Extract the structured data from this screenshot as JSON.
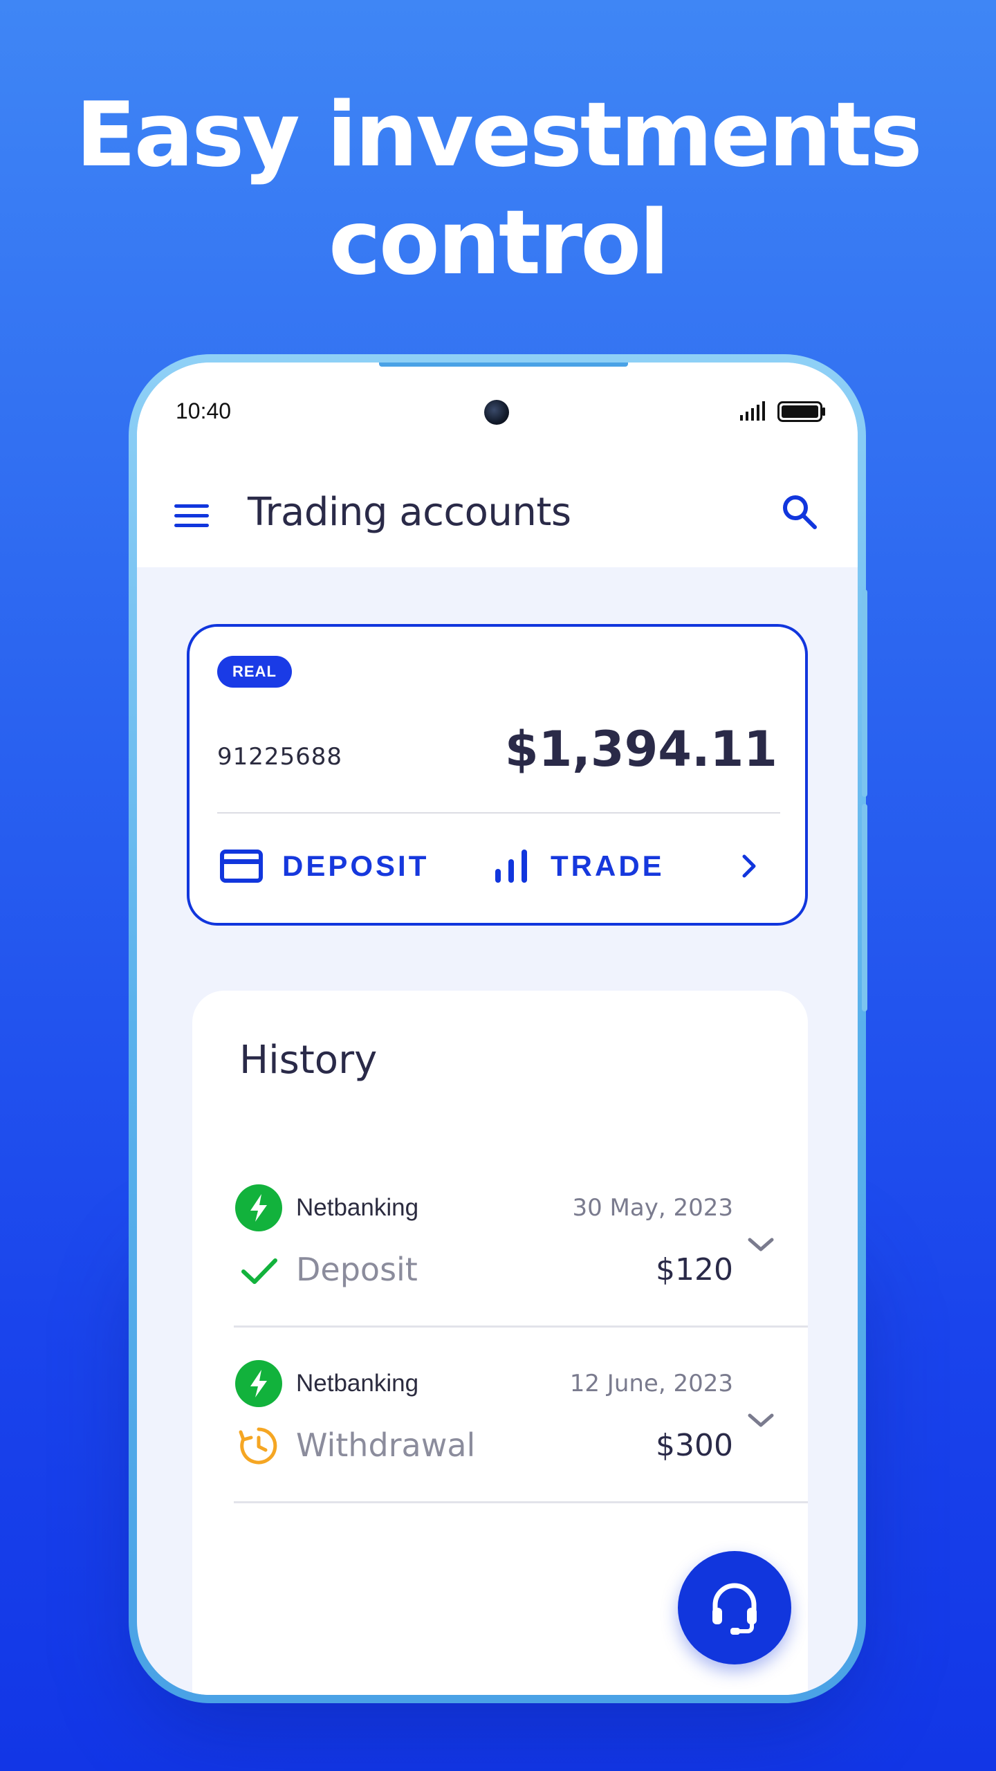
{
  "promo": {
    "headline_line1": "Easy investments",
    "headline_line2": "control"
  },
  "status_bar": {
    "time": "10:40",
    "icons": [
      "camera-hole",
      "signal-icon",
      "battery-icon"
    ]
  },
  "app_bar": {
    "title": "Trading accounts",
    "icons": [
      "menu-icon",
      "search-icon"
    ]
  },
  "account_card": {
    "badge": "REAL",
    "account_number": "91225688",
    "balance": "$1,394.11",
    "actions": [
      {
        "label": "DEPOSIT",
        "icon": "card-icon"
      },
      {
        "label": "TRADE",
        "icon": "bar-chart-icon"
      }
    ],
    "chevron_icon": "chevron-right-icon"
  },
  "history": {
    "title": "History",
    "items": [
      {
        "method": "Netbanking",
        "method_icon": "lightning-icon",
        "date": "30 May, 2023",
        "type": "Deposit",
        "status_icon": "check-icon",
        "amount": "$120"
      },
      {
        "method": "Netbanking",
        "method_icon": "lightning-icon",
        "date": "12 June, 2023",
        "type": "Withdrawal",
        "status_icon": "pending-clock-icon",
        "amount": "$300"
      }
    ]
  },
  "support_fab": {
    "icon": "headset-icon"
  },
  "colors": {
    "primary": "#1136dd",
    "success": "#12b23c",
    "pending": "#f5a623",
    "text_dark": "#2a2a48",
    "text_muted": "#8b8c9c",
    "background_gradient_top": "#3f86f5",
    "background_gradient_bottom": "#1236e6"
  }
}
